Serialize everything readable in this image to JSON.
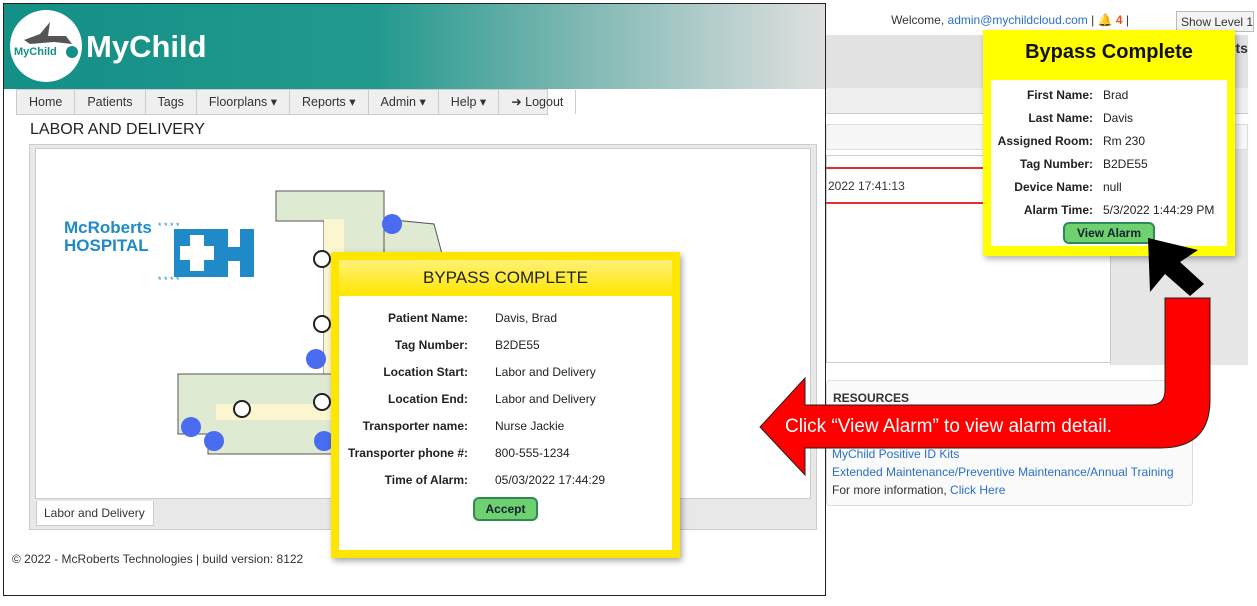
{
  "background_app": {
    "welcome_prefix": "Welcome, ",
    "user_email": "admin@mychildcloud.com",
    "alert_count": "4",
    "show_level_button": "Show Level 1",
    "logo_fragment": "rts",
    "table_time": "2022 17:41:13",
    "resources": {
      "heading": "RESOURCES",
      "links": [
        "MyChild Positive ID Kits",
        "Extended Maintenance/Preventive Maintenance/Annual Training"
      ],
      "more_info_prefix": "For more information, ",
      "more_info_link": "Click Here"
    }
  },
  "app": {
    "brand": "MyChild",
    "logo_text": "MyChild",
    "nav": [
      {
        "label": "Home"
      },
      {
        "label": "Patients"
      },
      {
        "label": "Tags"
      },
      {
        "label": "Floorplans ▾"
      },
      {
        "label": "Reports ▾"
      },
      {
        "label": "Admin ▾"
      },
      {
        "label": "Help ▾"
      },
      {
        "label": "Logout",
        "icon": "logout-icon"
      }
    ],
    "page_title": "LABOR AND DELIVERY",
    "hospital_logo": {
      "line1": "McRoberts",
      "line2": "HOSPITAL"
    },
    "floor_tab": "Labor and Delivery",
    "footer": "© 2022 - McRoberts Technologies | build version: 8122"
  },
  "alarm_popup": {
    "title": "BYPASS COMPLETE",
    "fields": [
      {
        "label": "Patient Name:",
        "value": "Davis, Brad"
      },
      {
        "label": "Tag Number:",
        "value": "B2DE55"
      },
      {
        "label": "Location Start:",
        "value": "Labor and Delivery"
      },
      {
        "label": "Location End:",
        "value": "Labor and Delivery"
      },
      {
        "label": "Transporter name:",
        "value": "Nurse Jackie"
      },
      {
        "label": "Transporter phone #:",
        "value": "800-555-1234"
      },
      {
        "label": "Time of Alarm:",
        "value": "05/03/2022 17:44:29"
      }
    ],
    "accept_button": "Accept"
  },
  "notification_popup": {
    "title": "Bypass Complete",
    "fields": [
      {
        "label": "First Name:",
        "value": "Brad"
      },
      {
        "label": "Last Name:",
        "value": "Davis"
      },
      {
        "label": "Assigned Room:",
        "value": "Rm 230"
      },
      {
        "label": "Tag Number:",
        "value": "B2DE55"
      },
      {
        "label": "Device Name:",
        "value": "null"
      },
      {
        "label": "Alarm Time:",
        "value": "5/3/2022 1:44:29 PM"
      }
    ],
    "view_alarm_button": "View Alarm"
  },
  "callout": {
    "text": "Click “View Alarm” to view alarm detail.",
    "color": "#ff0000"
  },
  "colors": {
    "header_teal": "#149087",
    "popup_yellow": "#ffe600",
    "button_green": "#6fd06f"
  }
}
